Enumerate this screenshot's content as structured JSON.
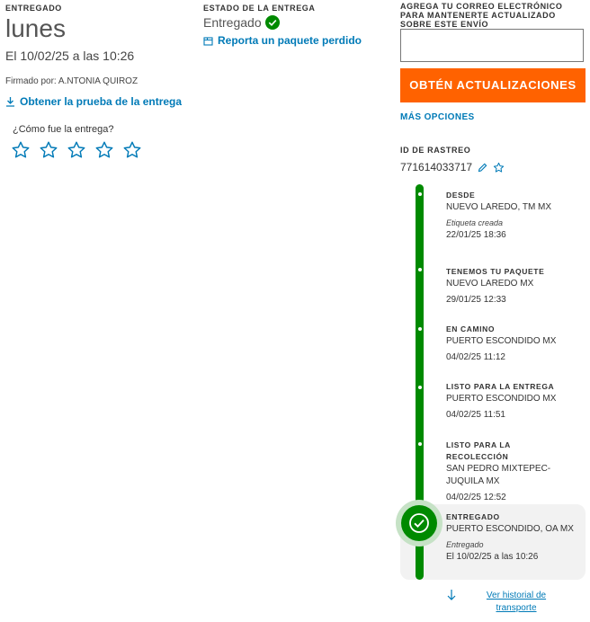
{
  "colors": {
    "accent": "#007ab7",
    "button": "#ff6200",
    "success": "#008a00"
  },
  "delivered": {
    "heading": "ENTREGADO",
    "day": "lunes",
    "datetime": "El 10/02/25 a las 10:26",
    "signed_by": "Firmado por: A.NTONIA QUIROZ",
    "proof_link": "Obtener la prueba de la entrega",
    "rate_question": "¿Cómo fue la entrega?",
    "rating_stars": 5,
    "rating_value": 0
  },
  "status": {
    "heading": "ESTADO DE LA ENTREGA",
    "value": "Entregado",
    "lost_link": "Reporta un paquete perdido"
  },
  "email": {
    "heading": "AGREGA TU CORREO ELECTRÓNICO PARA MANTENERTE ACTUALIZADO SOBRE ESTE ENVÍO",
    "input_value": "",
    "button_label": "OBTÉN ACTUALIZACIONES",
    "more_options": "MÁS OPCIONES"
  },
  "tracking": {
    "label": "ID DE RASTREO",
    "id": "771614033717"
  },
  "timeline": [
    {
      "status": "DESDE",
      "location": "NUEVO LAREDO, TM MX",
      "note": "Etiqueta creada",
      "datetime": "22/01/25 18:36"
    },
    {
      "status": "TENEMOS TU PAQUETE",
      "location": "NUEVO LAREDO MX",
      "note": "",
      "datetime": "29/01/25 12:33"
    },
    {
      "status": "EN CAMINO",
      "location": "PUERTO ESCONDIDO MX",
      "note": "",
      "datetime": "04/02/25 11:12"
    },
    {
      "status": "LISTO PARA LA ENTREGA",
      "location": "PUERTO ESCONDIDO MX",
      "note": "",
      "datetime": "04/02/25 11:51"
    },
    {
      "status": "LISTO PARA LA RECOLECCIÓN",
      "location": "SAN PEDRO MIXTEPEC-JUQUILA MX",
      "note": "",
      "datetime": "04/02/25 12:52"
    },
    {
      "status": "ENTREGADO",
      "location": "PUERTO ESCONDIDO, OA MX",
      "note": "Entregado",
      "datetime": "El 10/02/25 a las 10:26"
    }
  ],
  "history_link": "Ver historial de transporte",
  "icons": [
    "download-icon",
    "check-circle-icon",
    "package-icon",
    "star-icon",
    "pencil-icon",
    "arrow-down-icon",
    "check-icon"
  ]
}
